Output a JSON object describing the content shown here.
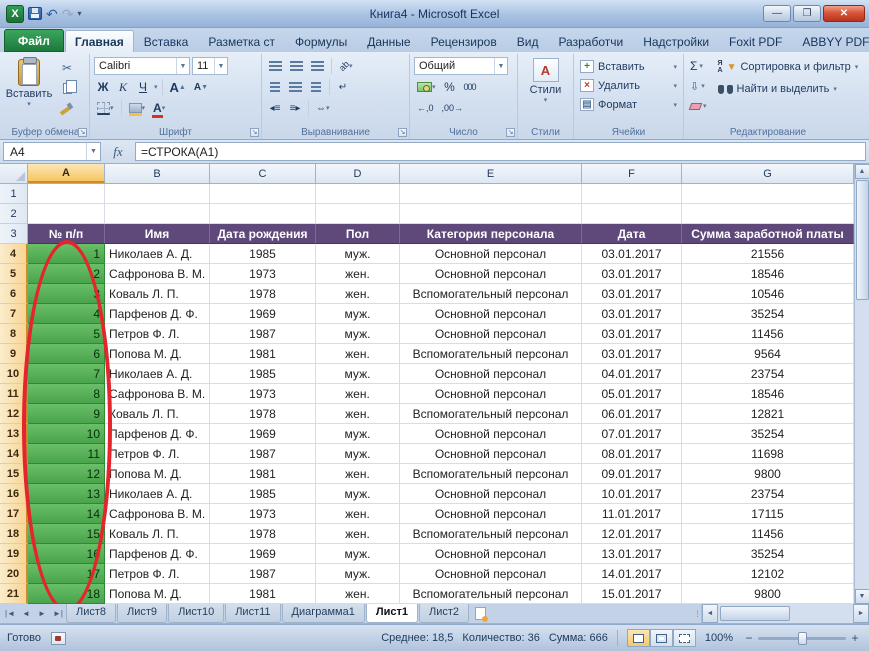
{
  "colors": {
    "table_header_bg": "#5f497b",
    "selected_fill_top": "#6abf69",
    "selected_fill": "#49a44b",
    "annotation": "#e4262c"
  },
  "window": {
    "title": "Книга4  -  Microsoft Excel"
  },
  "ribbon": {
    "tabs": [
      {
        "label": "Файл",
        "type": "file"
      },
      {
        "label": "Главная",
        "active": true
      },
      {
        "label": "Вставка"
      },
      {
        "label": "Разметка ст"
      },
      {
        "label": "Формулы"
      },
      {
        "label": "Данные"
      },
      {
        "label": "Рецензиров"
      },
      {
        "label": "Вид"
      },
      {
        "label": "Разработчи"
      },
      {
        "label": "Надстройки"
      },
      {
        "label": "Foxit PDF"
      },
      {
        "label": "ABBYY PDF T"
      }
    ],
    "clipboard": {
      "label": "Буфер обмена",
      "paste": "Вставить"
    },
    "font": {
      "label": "Шрифт",
      "family": "Calibri",
      "size": "11",
      "bold": "Ж",
      "italic": "К",
      "underline": "Ч",
      "grow": "А",
      "shrink": "А"
    },
    "alignment": {
      "label": "Выравнивание"
    },
    "number": {
      "label": "Число",
      "format": "Общий",
      "percent": "%",
      "thousands": "000"
    },
    "styles": {
      "label": "Стили",
      "button": "Стили"
    },
    "cells": {
      "label": "Ячейки",
      "insert": "Вставить",
      "delete": "Удалить",
      "format": "Формат"
    },
    "editing": {
      "label": "Редактирование",
      "autosum": "Σ",
      "sort": "Сортировка и фильтр",
      "find": "Найти и выделить"
    }
  },
  "formula_bar": {
    "name_box": "A4",
    "fx": "fx",
    "formula": "=СТРОКА(A1)"
  },
  "grid": {
    "columns": [
      "A",
      "B",
      "C",
      "D",
      "E",
      "F",
      "G"
    ],
    "selected_column": "A",
    "selected_rows_from": 4,
    "total_rows": 21,
    "header_row": [
      "№ п/п",
      "Имя",
      "Дата рождения",
      "Пол",
      "Категория персонала",
      "Дата",
      "Сумма заработной платы"
    ],
    "rows": [
      [
        "1",
        "Николаев А. Д.",
        "1985",
        "муж.",
        "Основной персонал",
        "03.01.2017",
        "21556"
      ],
      [
        "2",
        "Сафронова В. М.",
        "1973",
        "жен.",
        "Основной персонал",
        "03.01.2017",
        "18546"
      ],
      [
        "3",
        "Коваль Л. П.",
        "1978",
        "жен.",
        "Вспомогательный персонал",
        "03.01.2017",
        "10546"
      ],
      [
        "4",
        "Парфенов Д. Ф.",
        "1969",
        "муж.",
        "Основной персонал",
        "03.01.2017",
        "35254"
      ],
      [
        "5",
        "Петров Ф. Л.",
        "1987",
        "муж.",
        "Основной персонал",
        "03.01.2017",
        "11456"
      ],
      [
        "6",
        "Попова М. Д.",
        "1981",
        "жен.",
        "Вспомогательный персонал",
        "03.01.2017",
        "9564"
      ],
      [
        "7",
        "Николаев А. Д.",
        "1985",
        "муж.",
        "Основной персонал",
        "04.01.2017",
        "23754"
      ],
      [
        "8",
        "Сафронова В. М.",
        "1973",
        "жен.",
        "Основной персонал",
        "05.01.2017",
        "18546"
      ],
      [
        "9",
        "Коваль Л. П.",
        "1978",
        "жен.",
        "Вспомогательный персонал",
        "06.01.2017",
        "12821"
      ],
      [
        "10",
        "Парфенов Д. Ф.",
        "1969",
        "муж.",
        "Основной персонал",
        "07.01.2017",
        "35254"
      ],
      [
        "11",
        "Петров Ф. Л.",
        "1987",
        "муж.",
        "Основной персонал",
        "08.01.2017",
        "11698"
      ],
      [
        "12",
        "Попова М. Д.",
        "1981",
        "жен.",
        "Вспомогательный персонал",
        "09.01.2017",
        "9800"
      ],
      [
        "13",
        "Николаев А. Д.",
        "1985",
        "муж.",
        "Основной персонал",
        "10.01.2017",
        "23754"
      ],
      [
        "14",
        "Сафронова В. М.",
        "1973",
        "жен.",
        "Основной персонал",
        "11.01.2017",
        "17115"
      ],
      [
        "15",
        "Коваль Л. П.",
        "1978",
        "жен.",
        "Вспомогательный персонал",
        "12.01.2017",
        "11456"
      ],
      [
        "16",
        "Парфенов Д. Ф.",
        "1969",
        "муж.",
        "Основной персонал",
        "13.01.2017",
        "35254"
      ],
      [
        "17",
        "Петров Ф. Л.",
        "1987",
        "муж.",
        "Основной персонал",
        "14.01.2017",
        "12102"
      ],
      [
        "18",
        "Попова М. Д.",
        "1981",
        "жен.",
        "Вспомогательный персонал",
        "15.01.2017",
        "9800"
      ]
    ]
  },
  "sheets": {
    "tabs": [
      {
        "label": "Лист8"
      },
      {
        "label": "Лист9"
      },
      {
        "label": "Лист10"
      },
      {
        "label": "Лист11"
      },
      {
        "label": "Диаграмма1"
      },
      {
        "label": "Лист1",
        "active": true
      },
      {
        "label": "Лист2"
      }
    ]
  },
  "status": {
    "ready": "Готово",
    "average": "Среднее: 18,5",
    "count": "Количество: 36",
    "sum": "Сумма: 666",
    "zoom": "100%"
  }
}
